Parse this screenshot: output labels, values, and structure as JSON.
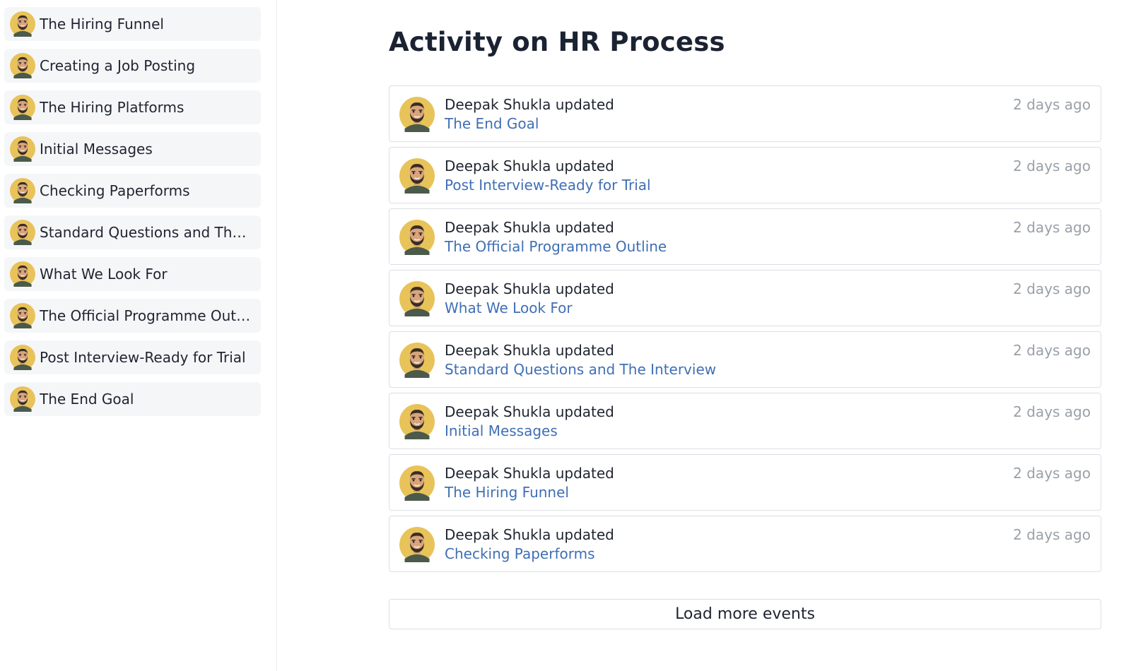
{
  "sidebar": {
    "items": [
      {
        "label": "The Hiring Funnel"
      },
      {
        "label": "Creating a Job Posting"
      },
      {
        "label": "The Hiring Platforms"
      },
      {
        "label": "Initial Messages"
      },
      {
        "label": "Checking Paperforms"
      },
      {
        "label": "Standard Questions and The In..."
      },
      {
        "label": "What We Look For"
      },
      {
        "label": "The Official Programme Outline"
      },
      {
        "label": "Post Interview-Ready for Trial"
      },
      {
        "label": "The End Goal"
      }
    ]
  },
  "main": {
    "title": "Activity on HR Process",
    "events": [
      {
        "actor": "Deepak Shukla updated",
        "target": "The End Goal",
        "time": "2 days ago"
      },
      {
        "actor": "Deepak Shukla updated",
        "target": "Post Interview-Ready for Trial",
        "time": "2 days ago"
      },
      {
        "actor": "Deepak Shukla updated",
        "target": "The Official Programme Outline",
        "time": "2 days ago"
      },
      {
        "actor": "Deepak Shukla updated",
        "target": "What We Look For",
        "time": "2 days ago"
      },
      {
        "actor": "Deepak Shukla updated",
        "target": "Standard Questions and The Interview",
        "time": "2 days ago"
      },
      {
        "actor": "Deepak Shukla updated",
        "target": "Initial Messages",
        "time": "2 days ago"
      },
      {
        "actor": "Deepak Shukla updated",
        "target": "The Hiring Funnel",
        "time": "2 days ago"
      },
      {
        "actor": "Deepak Shukla updated",
        "target": "Checking Paperforms",
        "time": "2 days ago"
      }
    ],
    "load_more_label": "Load more events"
  },
  "colors": {
    "link": "#3f6fb5",
    "muted": "#9aa0a8",
    "avatar_bg": "#e8c35a",
    "sidebar_item_bg": "#f5f6f8",
    "border": "#dcdfe4"
  },
  "icons": {
    "avatar": "user-avatar-icon"
  }
}
